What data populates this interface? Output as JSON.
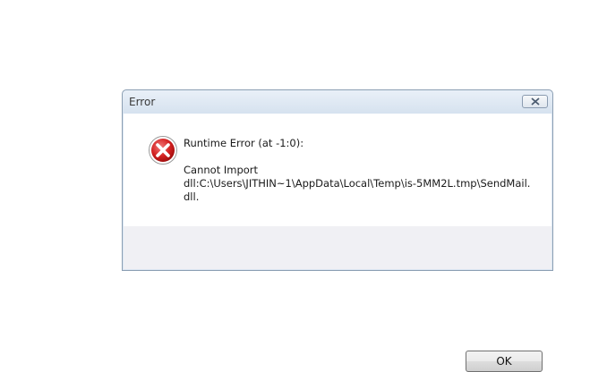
{
  "dialog": {
    "title": "Error",
    "close_icon": "close-x-icon",
    "icon": "error-red-circle-x-icon",
    "message_heading": "Runtime Error (at -1:0):",
    "message_line1": "Cannot Import",
    "message_line2": "dll:C:\\Users\\JITHIN~1\\AppData\\Local\\Temp\\is-5MM2L.tmp\\SendMail.",
    "message_line3": "dll.",
    "ok_label": "OK"
  },
  "colors": {
    "error_red": "#d21f1f",
    "border": "#8c9fb3",
    "footer_bg": "#f0f0f4"
  }
}
